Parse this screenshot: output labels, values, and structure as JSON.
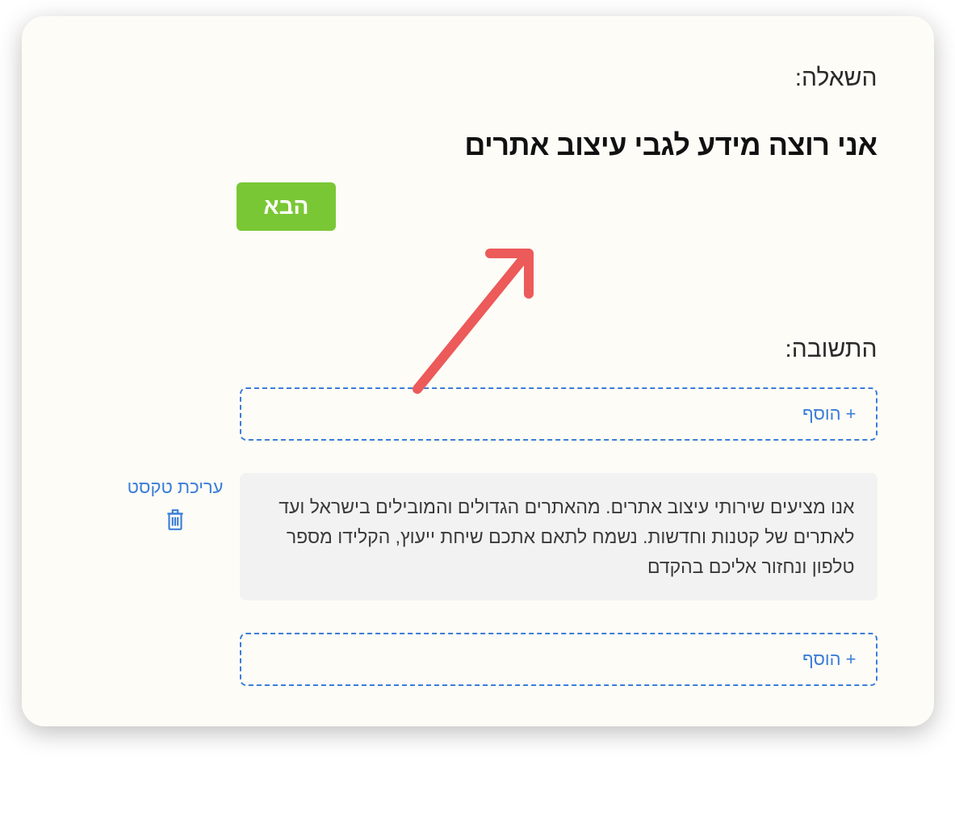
{
  "question": {
    "label": "השאלה:",
    "text": "אני רוצה מידע לגבי עיצוב אתרים"
  },
  "buttons": {
    "next": "הבא"
  },
  "answer": {
    "label": "התשובה:",
    "add_label": "+ הוסף",
    "edit_text": "עריכת טקסט",
    "content": "אנו מציעים שירותי עיצוב אתרים. מהאתרים הגדולים והמובילים בישראל ועד לאתרים של קטנות וחדשות. נשמח לתאם אתכם שיחת ייעוץ, הקלידו מספר טלפון ונחזור אליכם בהקדם"
  },
  "colors": {
    "primary_green": "#7ac735",
    "primary_blue": "#3b7dd8",
    "arrow_red": "#ec5a5a"
  }
}
